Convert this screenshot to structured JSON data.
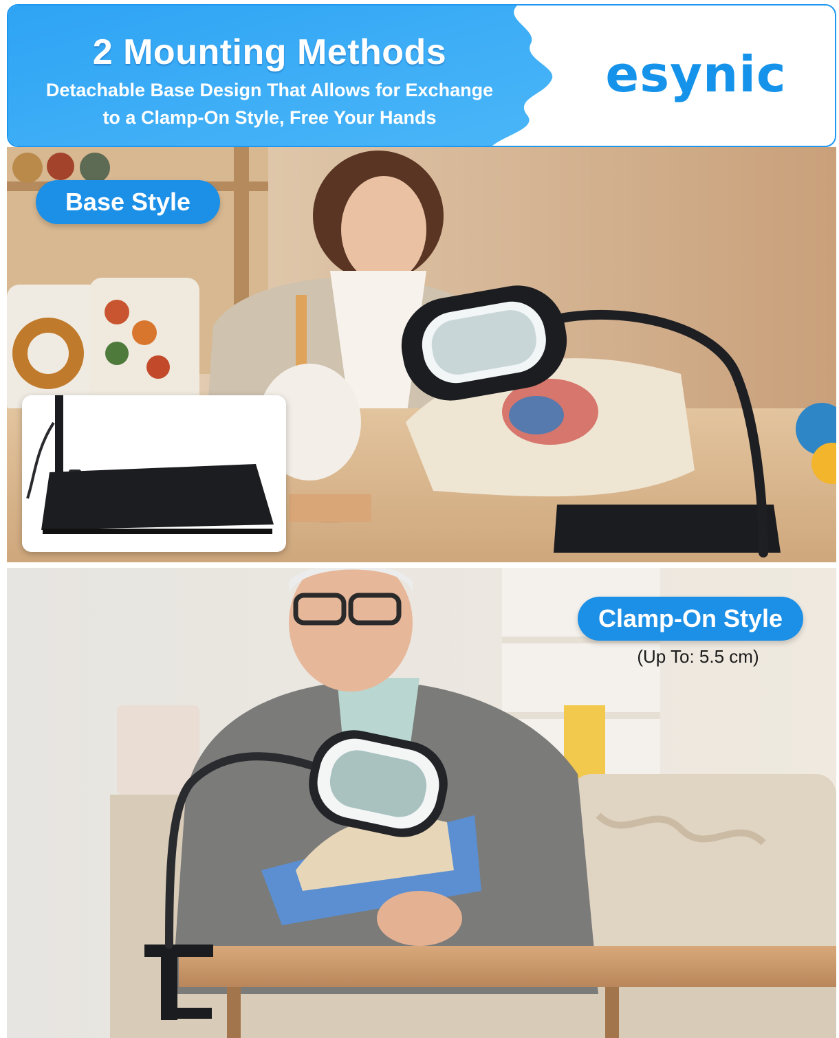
{
  "header": {
    "headline": "2 Mounting Methods",
    "subline_1": "Detachable Base Design That Allows for Exchange",
    "subline_2": "to a Clamp-On Style, Free Your Hands",
    "brand": "esynic"
  },
  "base_section": {
    "label": "Base Style"
  },
  "clamp_section": {
    "label": "Clamp-On Style",
    "note": "(Up To: 5.5 cm)"
  },
  "colors": {
    "accent_blue": "#1c8fe6",
    "brand_blue": "#1593ea",
    "banner_blue": "#35aaf6"
  }
}
